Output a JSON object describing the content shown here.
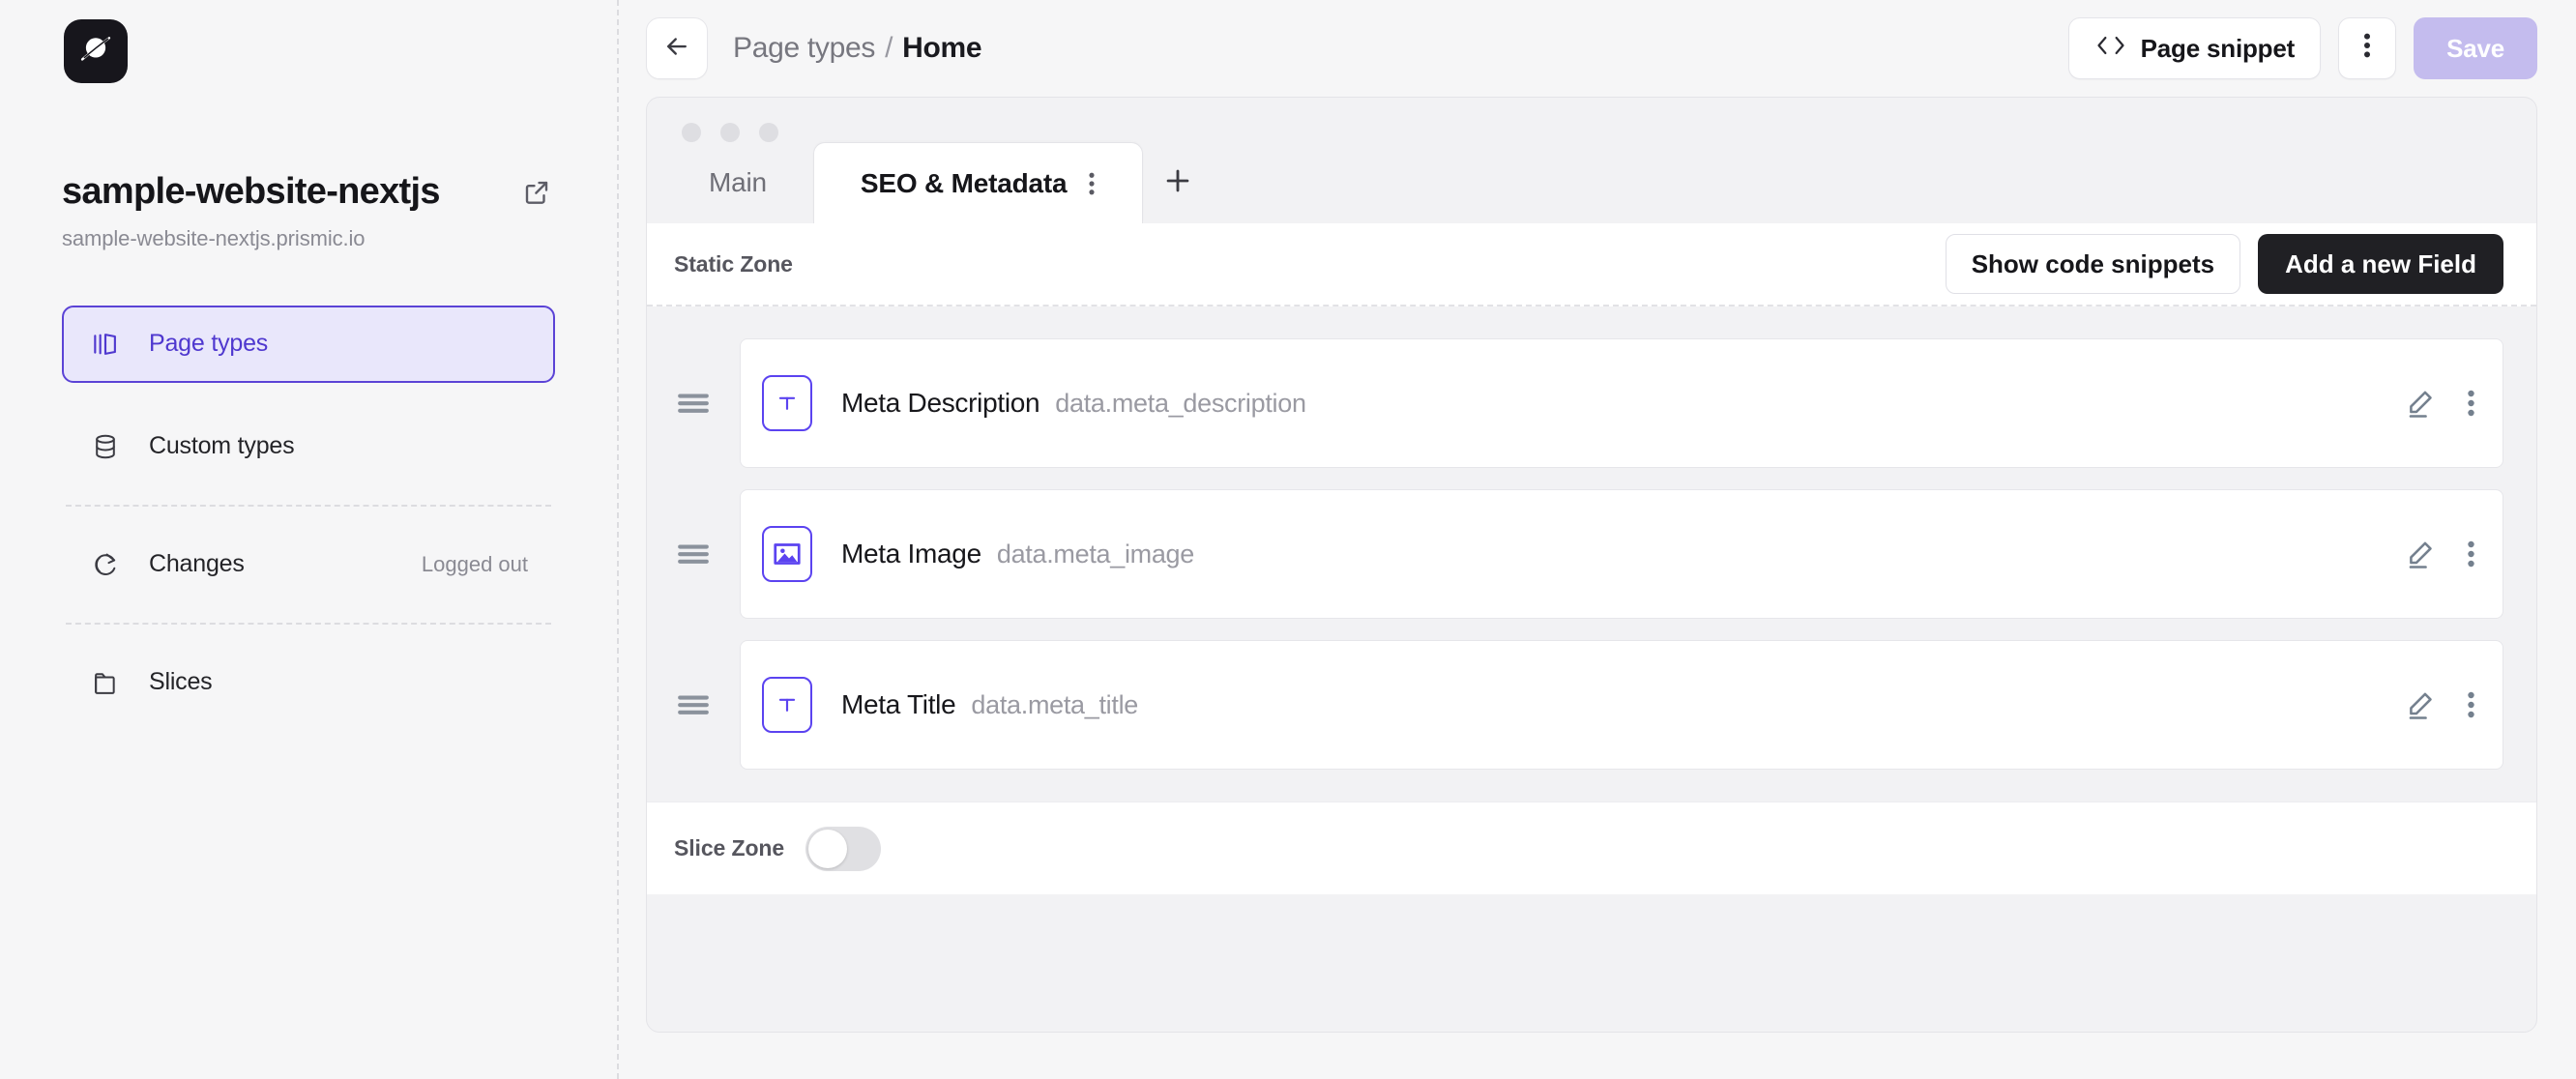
{
  "sidebar": {
    "logo_icon": "prismic-planet-icon",
    "repository": {
      "name": "sample-website-nextjs",
      "url": "sample-website-nextjs.prismic.io",
      "external_link_icon": "external-link-icon"
    },
    "items": [
      {
        "label": "Page types",
        "icon": "page-types-icon",
        "active": true,
        "meta": ""
      },
      {
        "label": "Custom types",
        "icon": "database-icon",
        "active": false,
        "meta": ""
      },
      {
        "label": "Changes",
        "icon": "sync-changes-icon",
        "active": false,
        "meta": "Logged out"
      },
      {
        "label": "Slices",
        "icon": "folder-icon",
        "active": false,
        "meta": ""
      }
    ]
  },
  "topbar": {
    "back_icon": "arrow-left-icon",
    "breadcrumb_parent": "Page types",
    "breadcrumb_separator": "/",
    "breadcrumb_current": "Home",
    "page_snippet_label": "Page snippet",
    "page_snippet_icon": "code-brackets-icon",
    "kebab_icon": "more-vertical-icon",
    "save_label": "Save",
    "save_disabled": true
  },
  "editor": {
    "window_dots": 3,
    "tabs": [
      {
        "label": "Main",
        "active": false,
        "has_menu": false
      },
      {
        "label": "SEO & Metadata",
        "active": true,
        "has_menu": true
      }
    ],
    "add_tab_icon": "plus-icon",
    "tab_menu_icon": "more-vertical-icon",
    "static_zone": {
      "title": "Static Zone",
      "show_snippets_label": "Show code snippets",
      "add_field_label": "Add a new Field"
    },
    "fields": [
      {
        "name": "Meta Description",
        "api_id": "data.meta_description",
        "icon": "text-field-icon",
        "drag_icon": "drag-handle-icon",
        "edit_icon": "pencil-edit-icon",
        "menu_icon": "more-vertical-icon"
      },
      {
        "name": "Meta Image",
        "api_id": "data.meta_image",
        "icon": "image-field-icon",
        "drag_icon": "drag-handle-icon",
        "edit_icon": "pencil-edit-icon",
        "menu_icon": "more-vertical-icon"
      },
      {
        "name": "Meta Title",
        "api_id": "data.meta_title",
        "icon": "text-field-icon",
        "drag_icon": "drag-handle-icon",
        "edit_icon": "pencil-edit-icon",
        "menu_icon": "more-vertical-icon"
      }
    ],
    "slice_zone": {
      "label": "Slice Zone",
      "enabled": false
    }
  },
  "colors": {
    "accent": "#5b43f0",
    "accent_soft_bg": "#e9e7fb",
    "accent_border": "#5b43d6",
    "dark_button": "#202024",
    "save_disabled_bg": "#c4bcee",
    "page_bg": "#f6f6f7",
    "muted_text": "#8a8a93"
  }
}
